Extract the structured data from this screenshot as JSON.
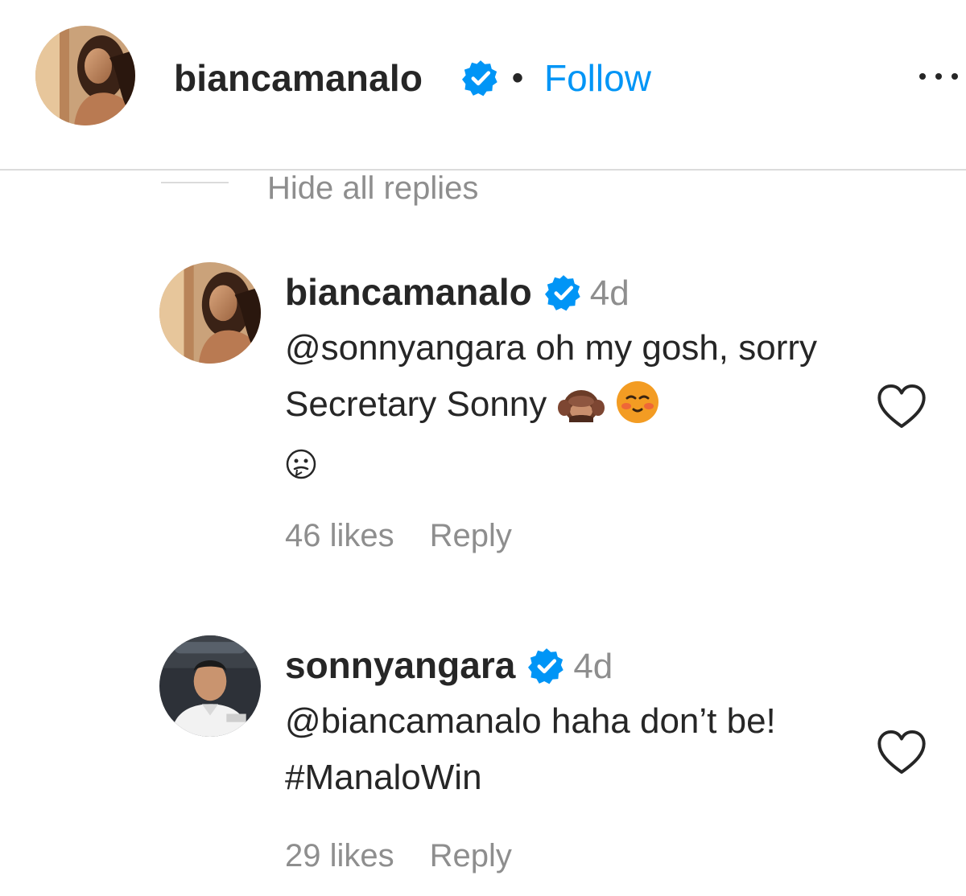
{
  "post_header": {
    "username": "biancamanalo",
    "separator": "•",
    "follow_label": "Follow",
    "verified_icon": "verified-badge-icon",
    "more_icon": "more-options-icon"
  },
  "thread": {
    "hide_replies_label": "Hide all replies"
  },
  "comments": [
    {
      "username": "biancamanalo",
      "time": "4d",
      "mention": "@sonnyangara",
      "text": "oh my gosh, sorry Secretary Sonny",
      "emojis": [
        "see-no-evil-monkey-emoji",
        "blushing-face-emoji",
        "woozy-face-emoji"
      ],
      "likes": "46 likes",
      "reply_label": "Reply",
      "avatar_icon": "user-avatar-icon"
    },
    {
      "username": "sonnyangara",
      "time": "4d",
      "mention": "@biancamanalo",
      "text": "haha don’t be! #ManaloWin",
      "likes": "29 likes",
      "reply_label": "Reply",
      "avatar_icon": "user-avatar-icon"
    }
  ],
  "colors": {
    "accent": "#0095f6",
    "text": "#262626",
    "muted": "#8e8e8e",
    "divider": "#dbdbdb"
  }
}
